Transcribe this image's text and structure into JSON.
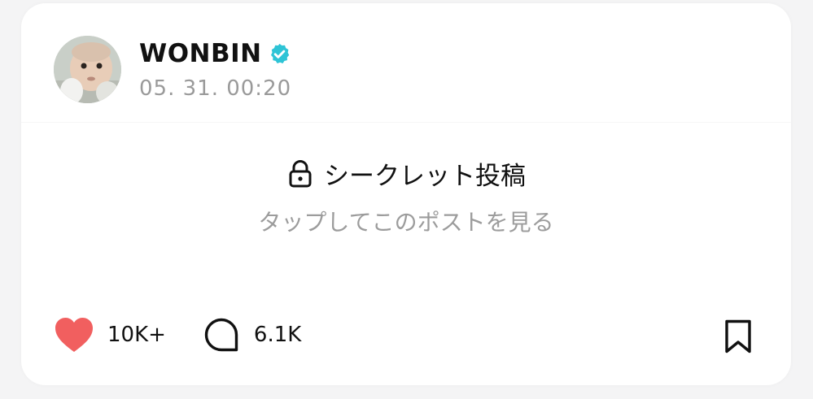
{
  "post": {
    "author": {
      "name": "WONBIN",
      "verified_icon": "verified-badge-icon",
      "avatar_icon": "avatar-photo"
    },
    "timestamp": "05. 31. 00:20",
    "secret": {
      "icon": "lock-icon",
      "title": "シークレット投稿",
      "subtitle": "タップしてこのポストを見る"
    },
    "actions": {
      "like": {
        "icon": "heart-icon",
        "count": "10K+"
      },
      "comment": {
        "icon": "comment-bubble-icon",
        "count": "6.1K"
      },
      "bookmark": {
        "icon": "bookmark-icon"
      }
    }
  },
  "colors": {
    "heart": "#f15f5f",
    "verified": "#2ec4d6",
    "text_primary": "#111111",
    "text_secondary": "#9a9a9a",
    "background": "#f4f4f5",
    "card": "#ffffff"
  }
}
